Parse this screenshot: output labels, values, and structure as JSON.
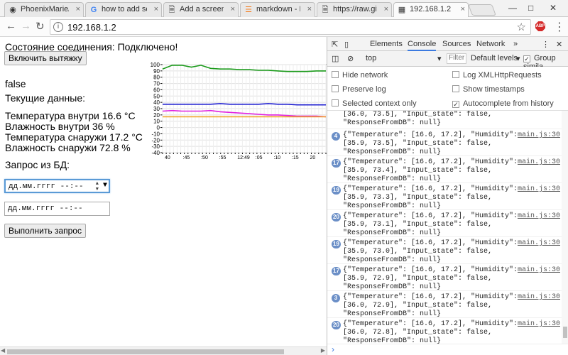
{
  "tabs": [
    {
      "title": "PhoenixMarie/es",
      "icon": "github-icon"
    },
    {
      "title": "how to add scre",
      "icon": "google-icon"
    },
    {
      "title": "Add a screenshot",
      "icon": "document-icon"
    },
    {
      "title": "markdown - Ho",
      "icon": "stackoverflow-icon"
    },
    {
      "title": "https://raw.githu",
      "icon": "document-icon"
    },
    {
      "title": "192.168.1.2",
      "icon": "page-icon"
    }
  ],
  "address": {
    "url": "192.168.1.2"
  },
  "toolbar": {
    "abp_label": "ABP"
  },
  "page": {
    "status": "Состояние соединения: Подключено!",
    "toggle_button": "Включить вытяжку",
    "state_value": "false",
    "current_heading": "Текущие данные:",
    "readings": [
      "Температура внутри 16.6 °C",
      "Влажность внутри 36 %",
      "Температура снаружи 17.2 °C",
      "Влажность снаружи 72.8 %"
    ],
    "db_label": "Запрос из БД:",
    "date_from": {
      "value": "дд.мм.гггг --:--"
    },
    "date_to": {
      "value": "дд.мм.гггг --:--"
    },
    "query_button": "Выполнить запрос"
  },
  "chart_data": {
    "type": "line",
    "ylim": [
      -40,
      100
    ],
    "y_ticks": [
      100,
      90,
      80,
      70,
      60,
      50,
      40,
      30,
      20,
      10,
      0,
      -10,
      -20,
      -30,
      -40
    ],
    "x_tick_labels": [
      "40",
      ":45",
      ":50",
      ":55",
      "12:49",
      ":05",
      ":10",
      ":15",
      "20"
    ],
    "series": [
      {
        "color": "#1a9a1a",
        "values": [
          93,
          99,
          99,
          96,
          99,
          94,
          93,
          93,
          92,
          92,
          91,
          91,
          90,
          89,
          89,
          89,
          90,
          90
        ]
      },
      {
        "color": "#2020d0",
        "values": [
          37,
          37,
          37,
          37,
          37,
          37,
          38,
          37,
          37,
          37,
          37,
          38,
          37,
          37,
          36,
          36,
          36,
          36
        ]
      },
      {
        "color": "#e020e0",
        "values": [
          26,
          27,
          26,
          26,
          26,
          27,
          25,
          24,
          23,
          22,
          21,
          20,
          20,
          19,
          18,
          18,
          18,
          17
        ]
      },
      {
        "color": "#f0a020",
        "values": [
          17,
          17,
          17,
          17,
          17,
          17,
          17,
          17,
          17,
          17,
          17,
          17,
          17,
          17,
          17,
          17,
          17,
          17
        ]
      }
    ]
  },
  "devtools": {
    "tabs": [
      "Elements",
      "Console",
      "Sources",
      "Network"
    ],
    "context": "top",
    "filter_placeholder": "Filter",
    "levels": "Default levels",
    "group_similar": "Group simila",
    "options": {
      "hide_network": "Hide network",
      "log_xhr": "Log XMLHttpRequests",
      "preserve_log": "Preserve log",
      "show_timestamps": "Show timestamps",
      "selected_context": "Selected context only",
      "autocomplete": "Autocomplete from history"
    },
    "log": [
      {
        "count": "",
        "msg": "[36.0, 73.5], \"Input_state\": false, \"ResponseFromDB\": null}",
        "src": ""
      },
      {
        "count": "4",
        "msg": "{\"Temperature\": [16.6, 17.2], \"Humidity\": [35.9, 73.5], \"Input_state\": false, \"ResponseFromDB\": null}",
        "src": "main.js:30"
      },
      {
        "count": "17",
        "msg": "{\"Temperature\": [16.6, 17.2], \"Humidity\": [35.9, 73.4], \"Input_state\": false, \"ResponseFromDB\": null}",
        "src": "main.js:30"
      },
      {
        "count": "19",
        "msg": "{\"Temperature\": [16.6, 17.2], \"Humidity\": [35.9, 73.3], \"Input_state\": false, \"ResponseFromDB\": null}",
        "src": "main.js:30"
      },
      {
        "count": "20",
        "msg": "{\"Temperature\": [16.6, 17.2], \"Humidity\": [35.9, 73.1], \"Input_state\": false, \"ResponseFromDB\": null}",
        "src": "main.js:30"
      },
      {
        "count": "19",
        "msg": "{\"Temperature\": [16.6, 17.2], \"Humidity\": [35.9, 73.0], \"Input_state\": false, \"ResponseFromDB\": null}",
        "src": "main.js:30"
      },
      {
        "count": "17",
        "msg": "{\"Temperature\": [16.6, 17.2], \"Humidity\": [35.9, 72.9], \"Input_state\": false, \"ResponseFromDB\": null}",
        "src": "main.js:30"
      },
      {
        "count": "3",
        "msg": "{\"Temperature\": [16.6, 17.2], \"Humidity\": [36.0, 72.9], \"Input_state\": false, \"ResponseFromDB\": null}",
        "src": "main.js:30"
      },
      {
        "count": "20",
        "msg": "{\"Temperature\": [16.6, 17.2], \"Humidity\": [36.0, 72.8], \"Input_state\": false, \"ResponseFromDB\": null}",
        "src": "main.js:30"
      }
    ]
  }
}
